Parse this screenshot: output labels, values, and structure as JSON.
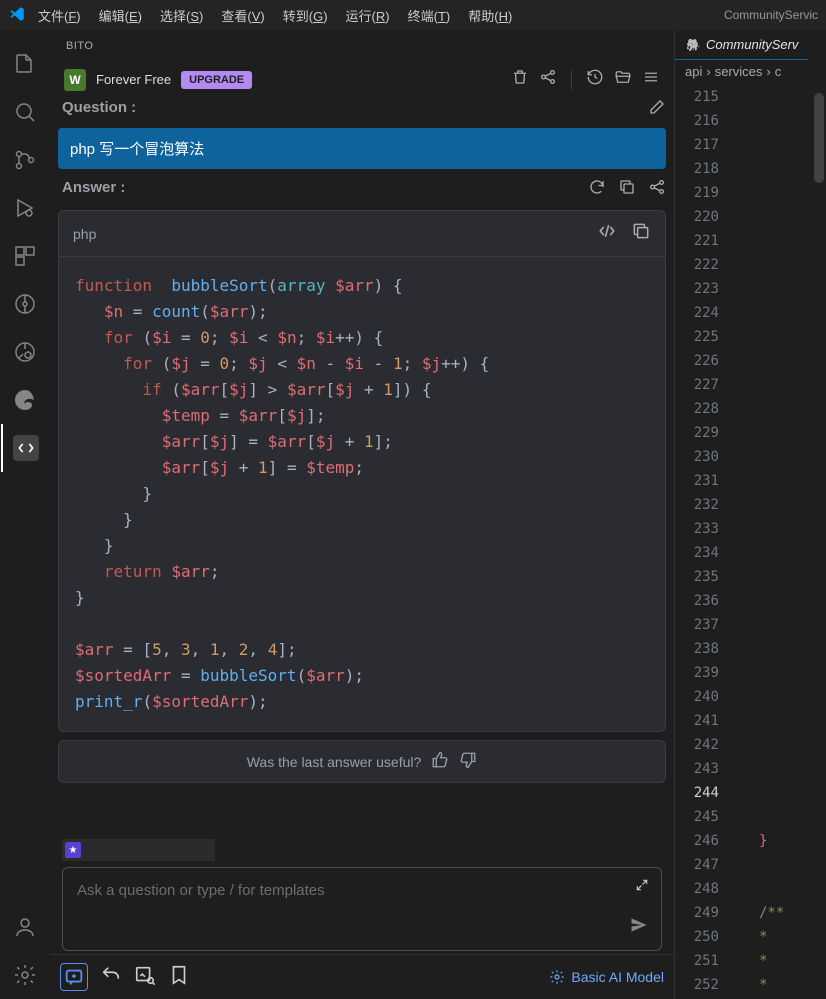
{
  "menu": [
    "文件(F)",
    "编辑(E)",
    "选择(S)",
    "查看(V)",
    "转到(G)",
    "运行(R)",
    "终端(T)",
    "帮助(H)"
  ],
  "menu_underline": [
    "F",
    "E",
    "S",
    "V",
    "G",
    "R",
    "T",
    "H"
  ],
  "window_title": "CommunityServic",
  "sidepanel_tab": "BITO",
  "bito": {
    "workspace_badge": "W",
    "plan": "Forever Free",
    "upgrade": "UPGRADE",
    "question_label": "Question :",
    "question": "php 写一个冒泡算法",
    "answer_label": "Answer :",
    "code_lang": "php",
    "feedback": "Was the last answer useful?",
    "ask_placeholder": "Ask a question or type / for templates",
    "model": "Basic AI Model"
  },
  "code_tokens": [
    [
      [
        "kw",
        "function"
      ],
      [
        "",
        "  "
      ],
      [
        "fn",
        "bubbleSort"
      ],
      [
        "op",
        "("
      ],
      [
        "type",
        "array"
      ],
      [
        "",
        " "
      ],
      [
        "var",
        "$arr"
      ],
      [
        "op",
        ") {"
      ]
    ],
    [
      [
        "",
        "   "
      ],
      [
        "var",
        "$n"
      ],
      [
        "op",
        " = "
      ],
      [
        "fn",
        "count"
      ],
      [
        "op",
        "("
      ],
      [
        "var",
        "$arr"
      ],
      [
        "op",
        ");"
      ]
    ],
    [
      [
        "",
        "   "
      ],
      [
        "kw",
        "for"
      ],
      [
        "op",
        " ("
      ],
      [
        "var",
        "$i"
      ],
      [
        "op",
        " = "
      ],
      [
        "num",
        "0"
      ],
      [
        "op",
        "; "
      ],
      [
        "var",
        "$i"
      ],
      [
        "op",
        " < "
      ],
      [
        "var",
        "$n"
      ],
      [
        "op",
        "; "
      ],
      [
        "var",
        "$i"
      ],
      [
        "op",
        "++) {"
      ]
    ],
    [
      [
        "",
        "     "
      ],
      [
        "kw",
        "for"
      ],
      [
        "op",
        " ("
      ],
      [
        "var",
        "$j"
      ],
      [
        "op",
        " = "
      ],
      [
        "num",
        "0"
      ],
      [
        "op",
        "; "
      ],
      [
        "var",
        "$j"
      ],
      [
        "op",
        " < "
      ],
      [
        "var",
        "$n"
      ],
      [
        "op",
        " - "
      ],
      [
        "var",
        "$i"
      ],
      [
        "op",
        " - "
      ],
      [
        "num",
        "1"
      ],
      [
        "op",
        "; "
      ],
      [
        "var",
        "$j"
      ],
      [
        "op",
        "++) {"
      ]
    ],
    [
      [
        "",
        "       "
      ],
      [
        "kw",
        "if"
      ],
      [
        "op",
        " ("
      ],
      [
        "var",
        "$arr"
      ],
      [
        "op",
        "["
      ],
      [
        "var",
        "$j"
      ],
      [
        "op",
        "] > "
      ],
      [
        "var",
        "$arr"
      ],
      [
        "op",
        "["
      ],
      [
        "var",
        "$j"
      ],
      [
        "op",
        " + "
      ],
      [
        "num",
        "1"
      ],
      [
        "op",
        "]) {"
      ]
    ],
    [
      [
        "",
        "         "
      ],
      [
        "var",
        "$temp"
      ],
      [
        "op",
        " = "
      ],
      [
        "var",
        "$arr"
      ],
      [
        "op",
        "["
      ],
      [
        "var",
        "$j"
      ],
      [
        "op",
        "];"
      ]
    ],
    [
      [
        "",
        "         "
      ],
      [
        "var",
        "$arr"
      ],
      [
        "op",
        "["
      ],
      [
        "var",
        "$j"
      ],
      [
        "op",
        "] = "
      ],
      [
        "var",
        "$arr"
      ],
      [
        "op",
        "["
      ],
      [
        "var",
        "$j"
      ],
      [
        "op",
        " + "
      ],
      [
        "num",
        "1"
      ],
      [
        "op",
        "];"
      ]
    ],
    [
      [
        "",
        "         "
      ],
      [
        "var",
        "$arr"
      ],
      [
        "op",
        "["
      ],
      [
        "var",
        "$j"
      ],
      [
        "op",
        " + "
      ],
      [
        "num",
        "1"
      ],
      [
        "op",
        "] = "
      ],
      [
        "var",
        "$temp"
      ],
      [
        "op",
        ";"
      ]
    ],
    [
      [
        "",
        "       "
      ],
      [
        "op",
        "}"
      ]
    ],
    [
      [
        "",
        "     "
      ],
      [
        "op",
        "}"
      ]
    ],
    [
      [
        "",
        "   "
      ],
      [
        "op",
        "}"
      ]
    ],
    [
      [
        "",
        "   "
      ],
      [
        "kw",
        "return"
      ],
      [
        "",
        " "
      ],
      [
        "var",
        "$arr"
      ],
      [
        "op",
        ";"
      ]
    ],
    [
      [
        "op",
        "}"
      ]
    ],
    [
      [
        "",
        ""
      ]
    ],
    [
      [
        "var",
        "$arr"
      ],
      [
        "op",
        " = ["
      ],
      [
        "num",
        "5"
      ],
      [
        "op",
        ", "
      ],
      [
        "num",
        "3"
      ],
      [
        "op",
        ", "
      ],
      [
        "num",
        "1"
      ],
      [
        "op",
        ", "
      ],
      [
        "num",
        "2"
      ],
      [
        "op",
        ", "
      ],
      [
        "num",
        "4"
      ],
      [
        "op",
        "];"
      ]
    ],
    [
      [
        "var",
        "$sortedArr"
      ],
      [
        "op",
        " = "
      ],
      [
        "fn",
        "bubbleSort"
      ],
      [
        "op",
        "("
      ],
      [
        "var",
        "$arr"
      ],
      [
        "op",
        ");"
      ]
    ],
    [
      [
        "fn",
        "print_r"
      ],
      [
        "op",
        "("
      ],
      [
        "var",
        "$sortedArr"
      ],
      [
        "op",
        ");"
      ]
    ]
  ],
  "editor": {
    "tab_name": "CommunityServ",
    "breadcrumbs": [
      "api",
      "services",
      "c"
    ],
    "line_start": 215,
    "line_end": 252,
    "current_line": 244,
    "lines": {
      "246": {
        "type": "brace",
        "text": "}",
        "indent": 1
      },
      "249": {
        "type": "cmt",
        "text": "/**",
        "indent": 1
      },
      "250": {
        "type": "cmt",
        "text": " * ",
        "indent": 1
      },
      "251": {
        "type": "cmt",
        "text": " * ",
        "indent": 1
      },
      "252": {
        "type": "cmt",
        "text": " *",
        "indent": 1
      }
    }
  }
}
